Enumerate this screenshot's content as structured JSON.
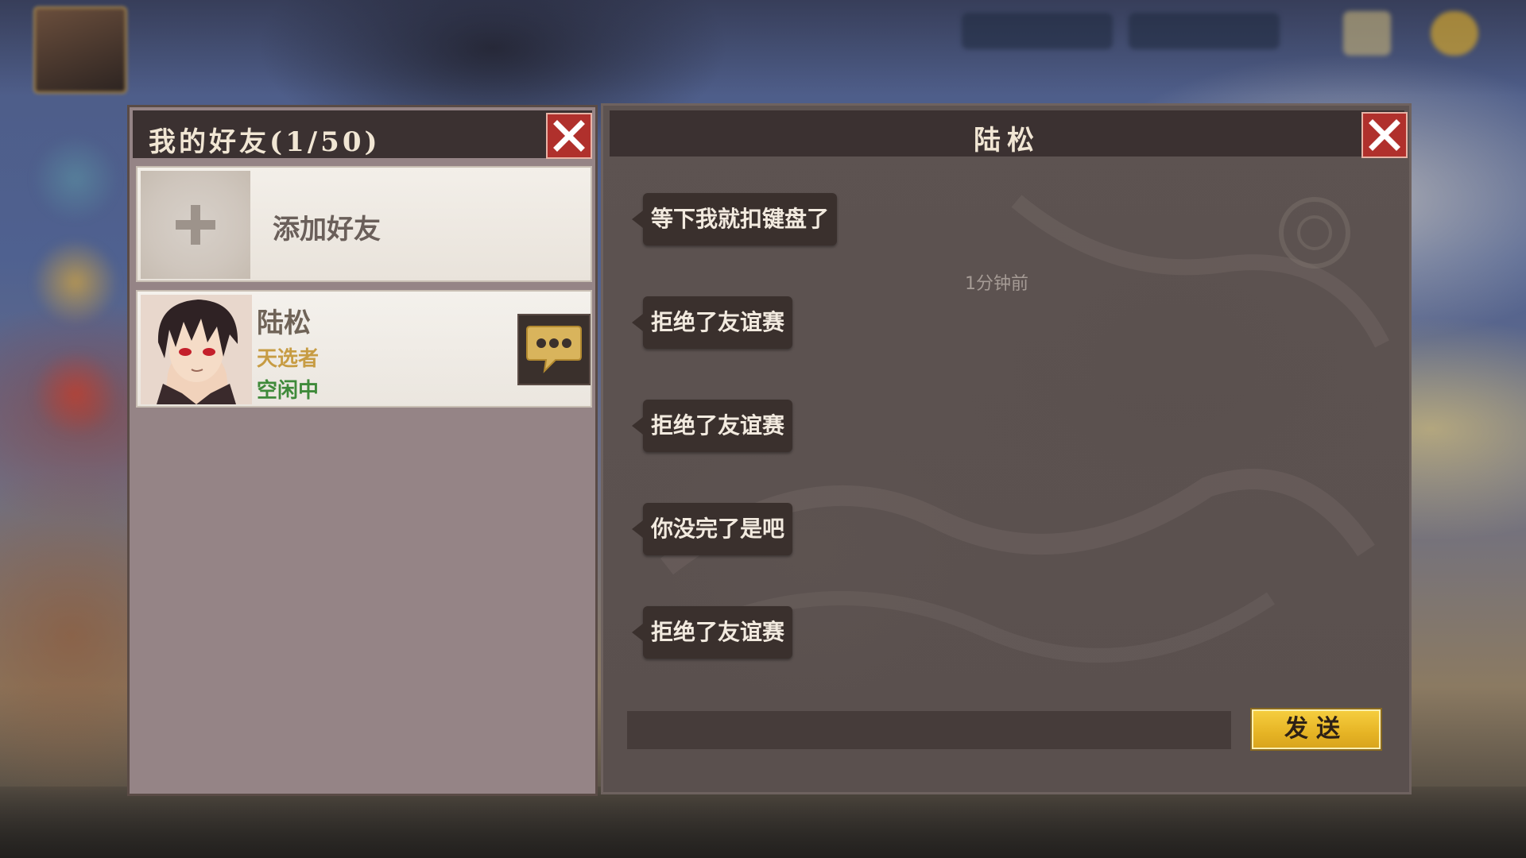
{
  "friends_panel": {
    "title": "我的好友(1/50)",
    "add_friend_label": "添加好友",
    "friends": [
      {
        "name": "陆松",
        "title": "天选者",
        "status": "空闲中"
      }
    ]
  },
  "chat_panel": {
    "title": "陆松",
    "messages": [
      {
        "text": "等下我就扣键盘了"
      },
      {
        "text": "拒绝了友谊赛"
      },
      {
        "text": "拒绝了友谊赛"
      },
      {
        "text": "你没完了是吧"
      },
      {
        "text": "拒绝了友谊赛"
      }
    ],
    "timestamp": "1分钟前",
    "input_value": "",
    "send_label": "发送"
  },
  "colors": {
    "header_bg": "#3b3131",
    "close_red": "#b0302c",
    "send_gold": "#f5cd3e",
    "friend_title_gold": "#c79c43",
    "status_green": "#3f8a3a"
  },
  "icons": {
    "close": "close-icon",
    "add": "plus-icon",
    "chat": "chat-bubble-icon"
  }
}
